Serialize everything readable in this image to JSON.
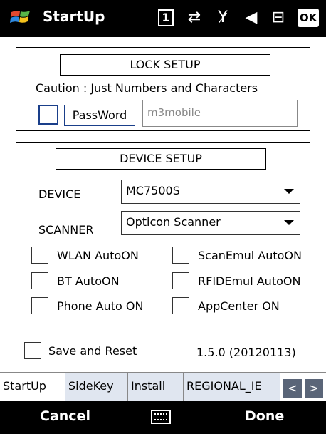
{
  "titlebar": {
    "title": "StartUp",
    "status_icons": [
      "sim-icon",
      "data-sync-icon",
      "no-signal-icon",
      "volume-icon",
      "battery-icon"
    ],
    "sim_number": "1",
    "ok_label": "OK"
  },
  "lock_setup": {
    "header": "LOCK SETUP",
    "caution": "Caution : Just Numbers and Characters",
    "password_label": "PassWord",
    "password_placeholder": "m3mobile",
    "password_checked": false
  },
  "device_setup": {
    "header": "DEVICE SETUP",
    "device_label": "DEVICE",
    "device_value": "MC7500S",
    "scanner_label": "SCANNER",
    "scanner_value": "Opticon Scanner",
    "options": {
      "wlan_autoon": "WLAN AutoON",
      "scanemul_autoon": "ScanEmul AutoON",
      "bt_autoon": "BT AutoON",
      "rfidemul_autoon": "RFIDEmul AutoON",
      "phone_auto_on": "Phone Auto ON",
      "appcenter_on": "AppCenter ON"
    }
  },
  "footer": {
    "save_reset_label": "Save and Reset",
    "version": "1.5.0 (20120113)"
  },
  "tabs": {
    "startup": "StartUp",
    "sidekey": "SideKey",
    "install": "Install",
    "regional": "REGIONAL_IE",
    "prev": "<",
    "next": ">"
  },
  "softkeys": {
    "left": "Cancel",
    "right": "Done",
    "keyboard_icon": "keyboard-icon"
  },
  "colors": {
    "titlebar_bg": "#000000",
    "focus_border": "#1a3f8a",
    "tab_inactive_bg": "#e0e6f0",
    "tab_nav_bg": "#5a6578"
  }
}
